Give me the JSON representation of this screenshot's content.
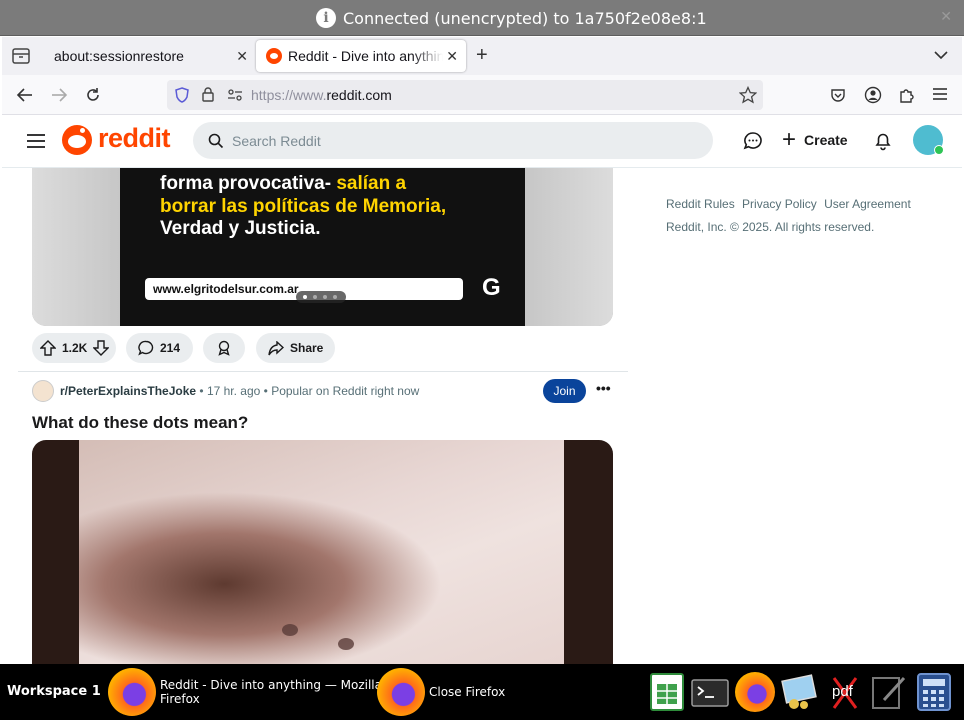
{
  "vnc": {
    "status": "Connected (unencrypted) to 1a750f2e08e8:1"
  },
  "browser": {
    "tabs": [
      {
        "label": "about:sessionrestore"
      },
      {
        "label": "Reddit - Dive into anything"
      }
    ],
    "url_prefix": "https://www.",
    "url_domain": "reddit.com"
  },
  "reddit": {
    "wordmark": "reddit",
    "search_placeholder": "Search Reddit",
    "create_label": "Create"
  },
  "post1": {
    "image_lines": [
      "forma provocativa- ",
      "salían a",
      "borrar las políticas de Memoria,",
      "Verdad y Justicia."
    ],
    "image_url": "www.elgritodelsur.com.ar",
    "image_logo": "G",
    "upvotes": "1.2K",
    "comments": "214",
    "share_label": "Share"
  },
  "post2": {
    "subreddit": "r/PeterExplainsTheJoke",
    "time": "• 17 hr. ago •",
    "popular": "Popular on Reddit right now",
    "join_label": "Join",
    "title": "What do these dots mean?"
  },
  "sidebar": {
    "links": [
      "Reddit Rules",
      "Privacy Policy",
      "User Agreement"
    ],
    "copyright": "Reddit, Inc. © 2025. All rights reserved."
  },
  "taskbar": {
    "workspace": "Workspace 1",
    "firefox_window_line1": "Reddit - Dive into anything — Mozilla",
    "firefox_window_line2": "Firefox",
    "close_firefox": "Close Firefox",
    "pdf_label": "pdf"
  },
  "colors": {
    "reddit_orange": "#ff4500",
    "join_blue": "#0a449b",
    "taskbar": "#000000"
  }
}
